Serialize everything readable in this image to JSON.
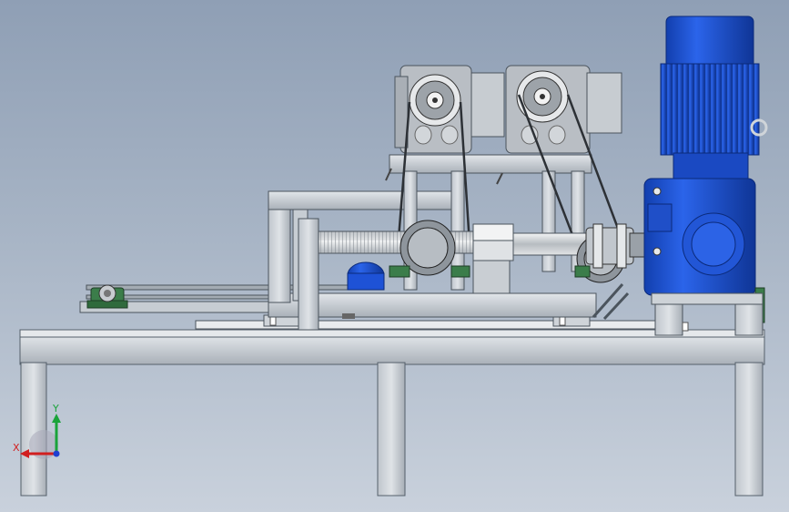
{
  "view": {
    "background_top": "#8f9fb5",
    "background_bottom": "#c9d1dc"
  },
  "triad": {
    "x_label": "X",
    "y_label": "Y",
    "x_color": "#d11f1f",
    "y_color": "#1aa33a",
    "z_color": "#1f3fd1"
  },
  "colors": {
    "frame": "#c9cfd6",
    "motor_blue": "#1e52d6",
    "gearbox_gray": "#b9bec4",
    "bearing_green": "#3b7d4a",
    "screw": "#d7dadd"
  }
}
